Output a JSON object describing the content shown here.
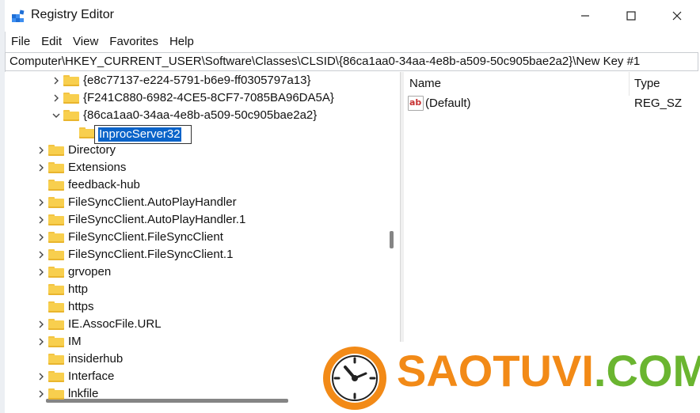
{
  "window": {
    "title": "Registry Editor",
    "controls": {
      "minimize": "minimize",
      "maximize": "maximize",
      "close": "close"
    }
  },
  "menu": [
    "File",
    "Edit",
    "View",
    "Favorites",
    "Help"
  ],
  "address": "Computer\\HKEY_CURRENT_USER\\Software\\Classes\\CLSID\\{86ca1aa0-34aa-4e8b-a509-50c905bae2a2}\\New Key #1",
  "tree": {
    "nodes": [
      {
        "label": "{e8c77137-e224-5791-b6e9-ff0305797a13}",
        "chevron": "right",
        "level": 1
      },
      {
        "label": "{F241C880-6982-4CE5-8CF7-7085BA96DA5A}",
        "chevron": "right",
        "level": 1
      },
      {
        "label": "{86ca1aa0-34aa-4e8b-a509-50c905bae2a2}",
        "chevron": "down",
        "level": 1
      },
      {
        "label": "",
        "chevron": "none",
        "level": 2,
        "editing": true
      },
      {
        "label": "Directory",
        "chevron": "right",
        "level": 0
      },
      {
        "label": "Extensions",
        "chevron": "right",
        "level": 0
      },
      {
        "label": "feedback-hub",
        "chevron": "none",
        "level": 0
      },
      {
        "label": "FileSyncClient.AutoPlayHandler",
        "chevron": "right",
        "level": 0
      },
      {
        "label": "FileSyncClient.AutoPlayHandler.1",
        "chevron": "right",
        "level": 0
      },
      {
        "label": "FileSyncClient.FileSyncClient",
        "chevron": "right",
        "level": 0
      },
      {
        "label": "FileSyncClient.FileSyncClient.1",
        "chevron": "right",
        "level": 0
      },
      {
        "label": "grvopen",
        "chevron": "right",
        "level": 0
      },
      {
        "label": "http",
        "chevron": "none",
        "level": 0
      },
      {
        "label": "https",
        "chevron": "none",
        "level": 0
      },
      {
        "label": "IE.AssocFile.URL",
        "chevron": "right",
        "level": 0
      },
      {
        "label": "IM",
        "chevron": "right",
        "level": 0
      },
      {
        "label": "insiderhub",
        "chevron": "none",
        "level": 0
      },
      {
        "label": "Interface",
        "chevron": "right",
        "level": 0
      },
      {
        "label": "lnkfile",
        "chevron": "right",
        "level": 0
      }
    ],
    "edit_value": "InprocServer32"
  },
  "values_pane": {
    "columns": {
      "name": "Name",
      "type": "Type"
    },
    "rows": [
      {
        "name": "(Default)",
        "type": "REG_SZ",
        "icon": "string-value-icon"
      }
    ]
  },
  "watermark": {
    "part1": "SAOTUVI",
    "part2": ".COM",
    "logo": "clock-logo"
  },
  "colors": {
    "selection": "#0a63c9",
    "folder": "#f8cf4e",
    "watermark_orange": "#f28a17",
    "watermark_green": "#6ab530"
  }
}
